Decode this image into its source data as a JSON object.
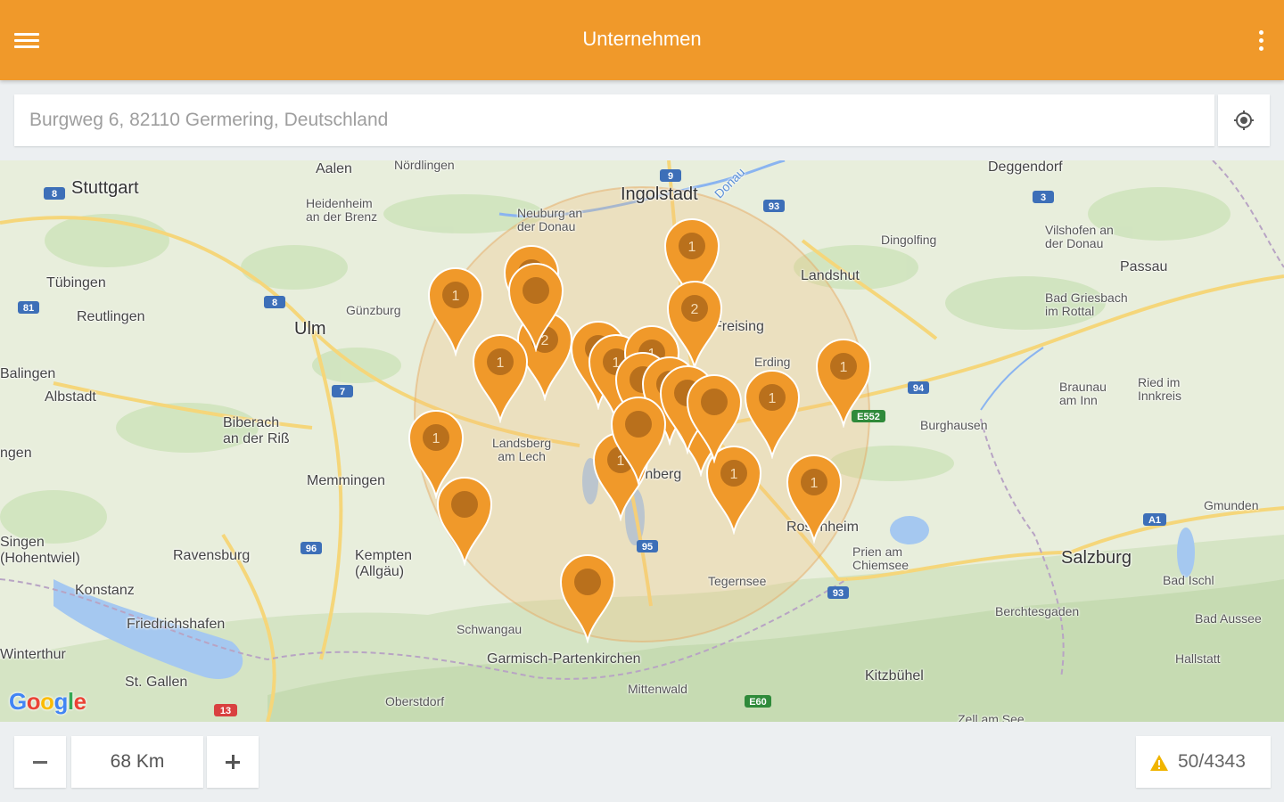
{
  "app": {
    "title": "Unternehmen",
    "accent": "#f0992a"
  },
  "search": {
    "value": "",
    "placeholder": "Burgweg 6, 82110 Germering, Deutschland"
  },
  "map": {
    "attribution": "Google",
    "cities": {
      "stuttgart": "Stuttgart",
      "aalen": "Aalen",
      "nordlingen": "Nördlingen",
      "ingolstadt": "Ingolstadt",
      "deggendorf": "Deggendorf",
      "heidenheim": "Heidenheim\nan der Brenz",
      "neuburg": "Neuburg an\nder Donau",
      "dingolfing": "Dingolfing",
      "vilshofen": "Vilshofen an\nder Donau",
      "passau": "Passau",
      "tubingen": "Tübingen",
      "reutlingen": "Reutlingen",
      "ulm": "Ulm",
      "gunzburg": "Günzburg",
      "landshut": "Landshut",
      "freising": "Freising",
      "erding": "Erding",
      "badgriesbach": "Bad Griesbach\nim Rottal",
      "balingen": "Balingen",
      "albstadt": "Albstadt",
      "biberach": "Biberach\nan der Riß",
      "landsberg": "Landsberg\nam Lech",
      "braunau": "Braunau\nam Inn",
      "ried": "Ried im\nInnkreis",
      "burghausen": "Burghausen",
      "memmingen": "Memmingen",
      "starnberg": "Starnberg",
      "singen": "Singen\n(Hohentwiel)",
      "ravensburg": "Ravensburg",
      "kempten": "Kempten\n(Allgäu)",
      "rosenheim": "Rosenheim",
      "prien": "Prien am\nChiemsee",
      "gmunden": "Gmunden",
      "salzburg": "Salzburg",
      "konstanz": "Konstanz",
      "friedrichshafen": "Friedrichshafen",
      "tegernsee": "Tegernsee",
      "badischl": "Bad Ischl",
      "badaussee": "Bad Aussee",
      "berchtesgaden": "Berchtesgaden",
      "schwangau": "Schwangau",
      "garmisch": "Garmisch-Partenkirchen",
      "hallstatt": "Hallstatt",
      "winterthur": "Winterthur",
      "stgallen": "St. Gallen",
      "mittenwald": "Mittenwald",
      "oberstdorf": "Oberstdorf",
      "kitzbuhel": "Kitzbühel",
      "zellamsee": "Zell am See",
      "ngen": "ngen",
      "donau": "Donau"
    },
    "roads": [
      "8",
      "9",
      "3",
      "93",
      "81",
      "8",
      "7",
      "94",
      "E552",
      "96",
      "95",
      "93",
      "A1",
      "E60",
      "13"
    ],
    "clusters": [
      "1",
      "",
      "2",
      "1",
      "2",
      "1",
      "2",
      "1",
      "1",
      "2",
      "1",
      "1",
      "1",
      "1",
      "1",
      "1",
      "",
      "",
      "",
      "",
      "",
      "",
      "",
      ""
    ]
  },
  "radius": {
    "decrement_label": "−",
    "value": "68",
    "unit": "Km",
    "increment_label": "+"
  },
  "results": {
    "shown": 50,
    "total": 4343,
    "label": "50/4343",
    "warning_color": "#f0b400"
  }
}
